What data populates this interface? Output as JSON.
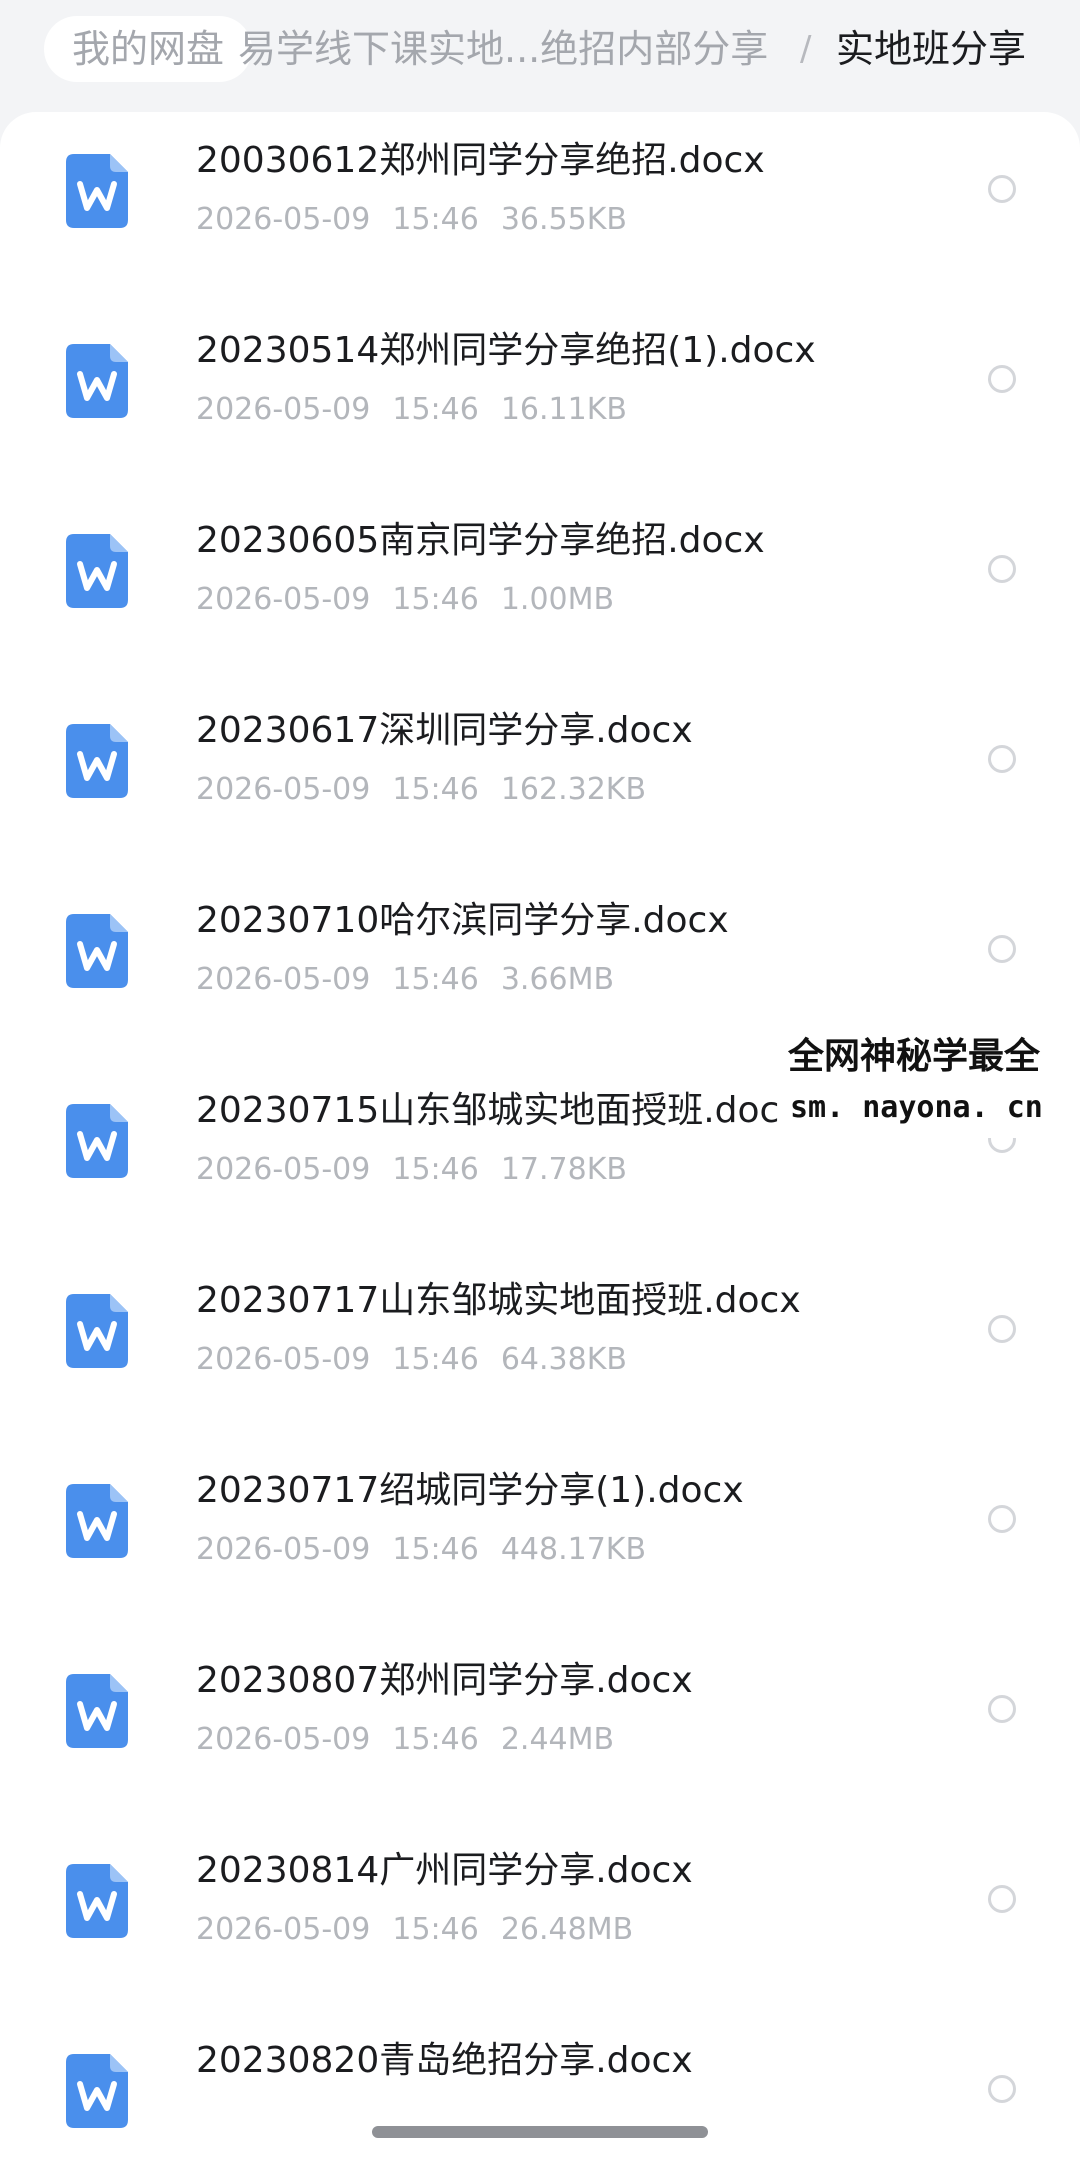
{
  "breadcrumb": {
    "home": "我的网盘",
    "path": "易学线下课实地...绝招内部分享",
    "separator": "/",
    "current": "实地班分享"
  },
  "files": [
    {
      "name": "20030612郑州同学分享绝招.docx",
      "date": "2026-05-09",
      "time": "15:46",
      "size": "36.55KB"
    },
    {
      "name": "20230514郑州同学分享绝招(1).docx",
      "date": "2026-05-09",
      "time": "15:46",
      "size": "16.11KB"
    },
    {
      "name": "20230605南京同学分享绝招.docx",
      "date": "2026-05-09",
      "time": "15:46",
      "size": "1.00MB"
    },
    {
      "name": "20230617深圳同学分享.docx",
      "date": "2026-05-09",
      "time": "15:46",
      "size": "162.32KB"
    },
    {
      "name": "20230710哈尔滨同学分享.docx",
      "date": "2026-05-09",
      "time": "15:46",
      "size": "3.66MB"
    },
    {
      "name": "20230715山东邹城实地面授班.docx",
      "date": "2026-05-09",
      "time": "15:46",
      "size": "17.78KB"
    },
    {
      "name": "20230717山东邹城实地面授班.docx",
      "date": "2026-05-09",
      "time": "15:46",
      "size": "64.38KB"
    },
    {
      "name": "20230717绍城同学分享(1).docx",
      "date": "2026-05-09",
      "time": "15:46",
      "size": "448.17KB"
    },
    {
      "name": "20230807郑州同学分享.docx",
      "date": "2026-05-09",
      "time": "15:46",
      "size": "2.44MB"
    },
    {
      "name": "20230814广州同学分享.docx",
      "date": "2026-05-09",
      "time": "15:46",
      "size": "26.48MB"
    },
    {
      "name": "20230820青岛绝招分享.docx",
      "date": "",
      "time": "",
      "size": ""
    }
  ],
  "icons": {
    "file": "word-document-icon",
    "select": "radio-circle-icon"
  },
  "colors": {
    "word_icon": "#4a8fec",
    "title_text": "#1b1c1f",
    "meta_text": "#b3b6bb",
    "background": "#f3f4f6"
  },
  "watermark": {
    "line1": "全网神秘学最全",
    "line2": "sm. nayona. cn"
  }
}
